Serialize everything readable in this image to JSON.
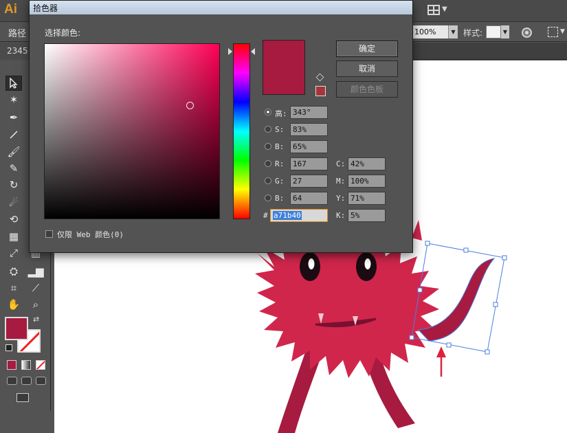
{
  "app": {
    "logo": "Ai",
    "control_label": "路径",
    "document_tab": "2345",
    "opacity": "100%",
    "style_label": "样式:"
  },
  "colors": {
    "selected": "#a71b40",
    "websafe": "#a5343c",
    "monster_body": "#d1264c",
    "monster_dark": "#a71b40",
    "selection": "#4a7de0",
    "arrow": "#e0203a"
  },
  "picker": {
    "title": "拾色器",
    "heading": "选择颜色:",
    "buttons": {
      "ok": "确定",
      "cancel": "取消",
      "swatches": "颜色色板"
    },
    "hsb": [
      {
        "label": "高:",
        "value": "343°",
        "selected": true
      },
      {
        "label": "S:",
        "value": "83%",
        "selected": false
      },
      {
        "label": "B:",
        "value": "65%",
        "selected": false
      }
    ],
    "rgb": [
      {
        "label": "R:",
        "value": "167"
      },
      {
        "label": "G:",
        "value": "27"
      },
      {
        "label": "B:",
        "value": "64"
      }
    ],
    "cmyk": [
      {
        "label": "C:",
        "value": "42%"
      },
      {
        "label": "M:",
        "value": "100%"
      },
      {
        "label": "Y:",
        "value": "71%"
      },
      {
        "label": "K:",
        "value": "5%"
      }
    ],
    "hex_label": "#",
    "hex": "a71b40",
    "web_only_label": "仅限 Web 颜色(0)",
    "web_only_checked": false,
    "hue_degrees": 343,
    "saturation": 0.83,
    "brightness": 0.65
  },
  "tools": [
    "selection-tool-icon",
    "magic-wand-icon",
    "pen-tool-icon",
    "line-tool-icon",
    "paintbrush-icon",
    "shaper-tool-icon",
    "rotate-tool-icon",
    "warp-tool-icon",
    "free-transform-icon",
    "mesh-tool-icon",
    "eyedropper-icon",
    "graph-tool-icon",
    "symbol-sprayer-icon",
    "artboard-tool-icon",
    "slice-tool-icon",
    "hand-tool-icon",
    "zoom-tool-icon"
  ]
}
